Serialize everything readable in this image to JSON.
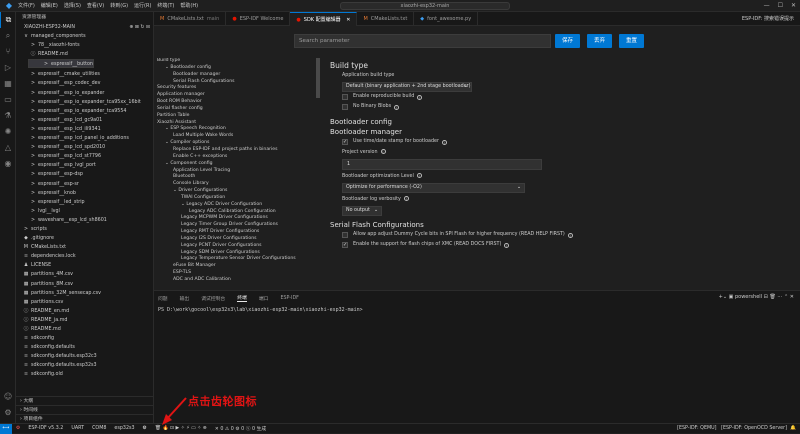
{
  "titlebar": {
    "menus": [
      "文件(F)",
      "编辑(E)",
      "选择(S)",
      "查看(V)",
      "转到(G)",
      "运行(R)",
      "终端(T)",
      "帮助(H)"
    ],
    "search": "xiaozhi-esp32-main"
  },
  "sidebar": {
    "header": "资源管理器",
    "project": "XIAOZHI-ESP32-MAIN",
    "tree": [
      {
        "label": "managed_components",
        "indent": 1,
        "icon": "v"
      },
      {
        "label": "78__xiaozhi-fonts",
        "indent": 2,
        "icon": ">"
      },
      {
        "label": "README.md",
        "indent": 2,
        "icon": "ⓘ"
      },
      {
        "label": "espressif__button",
        "indent": 2,
        "icon": ">",
        "selected": true
      },
      {
        "label": "espressif__cmake_utilities",
        "indent": 2,
        "icon": ">"
      },
      {
        "label": "espressif__esp_codec_dev",
        "indent": 2,
        "icon": ">"
      },
      {
        "label": "espressif__esp_io_expander",
        "indent": 2,
        "icon": ">"
      },
      {
        "label": "espressif__esp_io_expander_tca95xx_16bit",
        "indent": 2,
        "icon": ">"
      },
      {
        "label": "espressif__esp_io_expander_tca9554",
        "indent": 2,
        "icon": ">"
      },
      {
        "label": "espressif__esp_lcd_gc9a01",
        "indent": 2,
        "icon": ">"
      },
      {
        "label": "espressif__esp_lcd_ili9341",
        "indent": 2,
        "icon": ">"
      },
      {
        "label": "espressif__esp_lcd_panel_io_additions",
        "indent": 2,
        "icon": ">"
      },
      {
        "label": "espressif__esp_lcd_spd2010",
        "indent": 2,
        "icon": ">"
      },
      {
        "label": "espressif__esp_lcd_st7796",
        "indent": 2,
        "icon": ">"
      },
      {
        "label": "espressif__esp_lvgl_port",
        "indent": 2,
        "icon": ">"
      },
      {
        "label": "espressif__esp-dsp",
        "indent": 2,
        "icon": ">"
      },
      {
        "label": "espressif__esp-sr",
        "indent": 2,
        "icon": ">"
      },
      {
        "label": "espressif__knob",
        "indent": 2,
        "icon": ">"
      },
      {
        "label": "espressif__led_strip",
        "indent": 2,
        "icon": ">"
      },
      {
        "label": "lvgl__lvgl",
        "indent": 2,
        "icon": ">"
      },
      {
        "label": "waveshare__esp_lcd_sh8601",
        "indent": 2,
        "icon": ">"
      },
      {
        "label": "scripts",
        "indent": 1,
        "icon": ">"
      },
      {
        "label": ".gitignore",
        "indent": 1,
        "icon": "◆"
      },
      {
        "label": "CMakeLists.txt",
        "indent": 1,
        "icon": "M"
      },
      {
        "label": "dependencies.lock",
        "indent": 1,
        "icon": "≡"
      },
      {
        "label": "LICENSE",
        "indent": 1,
        "icon": "♟"
      },
      {
        "label": "partitions_4M.csv",
        "indent": 1,
        "icon": "▦"
      },
      {
        "label": "partitions_8M.csv",
        "indent": 1,
        "icon": "▦"
      },
      {
        "label": "partitions_32M_sensecap.csv",
        "indent": 1,
        "icon": "▦"
      },
      {
        "label": "partitions.csv",
        "indent": 1,
        "icon": "▦"
      },
      {
        "label": "README_en.md",
        "indent": 1,
        "icon": "ⓘ"
      },
      {
        "label": "README_ja.md",
        "indent": 1,
        "icon": "ⓘ"
      },
      {
        "label": "README.md",
        "indent": 1,
        "icon": "ⓘ"
      },
      {
        "label": "sdkconfig",
        "indent": 1,
        "icon": "≡"
      },
      {
        "label": "sdkconfig.defaults",
        "indent": 1,
        "icon": "≡"
      },
      {
        "label": "sdkconfig.defaults.esp32c3",
        "indent": 1,
        "icon": "≡"
      },
      {
        "label": "sdkconfig.defaults.esp32s3",
        "indent": 1,
        "icon": "≡"
      },
      {
        "label": "sdkconfig.old",
        "indent": 1,
        "icon": "≡"
      }
    ],
    "bottom": [
      "大纲",
      "时间线",
      "项目组件"
    ]
  },
  "tabs": [
    {
      "label": "CMakeLists.txt",
      "suffix": "main",
      "icon": "M",
      "color": "#e37933",
      "active": false
    },
    {
      "label": "ESP-IDF Welcome",
      "suffix": "",
      "icon": "●",
      "color": "#e51400",
      "active": false
    },
    {
      "label": "SDK 配置编辑器",
      "suffix": "",
      "icon": "●",
      "color": "#e51400",
      "active": true
    },
    {
      "label": "CMakeLists.txt",
      "suffix": "",
      "icon": "M",
      "color": "#e37933",
      "active": false
    },
    {
      "label": "font_awesome.py",
      "suffix": "",
      "icon": "◆",
      "color": "#3c9df0",
      "active": false
    }
  ],
  "tabs_right": "ESP-IDF: 搜索错误提示",
  "editor": {
    "search_placeholder": "Search parameter",
    "buttons": {
      "save": "保存",
      "discard": "丢弃",
      "reset": "重置"
    },
    "menu": [
      {
        "label": "Build type",
        "indent": 0
      },
      {
        "label": "Bootloader config",
        "indent": 1,
        "chev": "v"
      },
      {
        "label": "Bootloader manager",
        "indent": 2
      },
      {
        "label": "Serial Flash Configurations",
        "indent": 2
      },
      {
        "label": "Security features",
        "indent": 0
      },
      {
        "label": "Application manager",
        "indent": 0
      },
      {
        "label": "Boot ROM Behavior",
        "indent": 0
      },
      {
        "label": "Serial flasher config",
        "indent": 0
      },
      {
        "label": "Partition Table",
        "indent": 0
      },
      {
        "label": "Xiaozhi Assistant",
        "indent": 0
      },
      {
        "label": "ESP Speech Recognition",
        "indent": 1,
        "chev": "v"
      },
      {
        "label": "Load Multiple Wake Words",
        "indent": 2
      },
      {
        "label": "Compiler options",
        "indent": 1,
        "chev": "v"
      },
      {
        "label": "Replace ESP-IDF and project paths in binaries",
        "indent": 2
      },
      {
        "label": "Enable C++ exceptions",
        "indent": 2
      },
      {
        "label": "Component config",
        "indent": 1,
        "chev": "v"
      },
      {
        "label": "Application Level Tracing",
        "indent": 2
      },
      {
        "label": "Bluetooth",
        "indent": 2
      },
      {
        "label": "Console Library",
        "indent": 2
      },
      {
        "label": "Driver Configurations",
        "indent": 2,
        "chev": "v"
      },
      {
        "label": "TWAI Configuration",
        "indent": 3
      },
      {
        "label": "Legacy ADC Driver Configuration",
        "indent": 3,
        "chev": "v"
      },
      {
        "label": "Legacy ADC Calibration Configuration",
        "indent": 4
      },
      {
        "label": "Legacy MCPWM Driver Configurations",
        "indent": 3
      },
      {
        "label": "Legacy Timer Group Driver Configurations",
        "indent": 3
      },
      {
        "label": "Legacy RMT Driver Configurations",
        "indent": 3
      },
      {
        "label": "Legacy I2S Driver Configurations",
        "indent": 3
      },
      {
        "label": "Legacy PCNT Driver Configurations",
        "indent": 3
      },
      {
        "label": "Legacy SDM Driver Configurations",
        "indent": 3
      },
      {
        "label": "Legacy Temperature Sensor Driver Configurations",
        "indent": 3
      },
      {
        "label": "eFuse Bit Manager",
        "indent": 2
      },
      {
        "label": "ESP-TLS",
        "indent": 2
      },
      {
        "label": "ADC and ADC Calibration",
        "indent": 2
      }
    ],
    "content": {
      "build_type_title": "Build type",
      "app_build_type_label": "Application build type",
      "app_build_type_value": "Default (binary application + 2nd stage bootloader)",
      "reproducible_label": "Enable reproducible build",
      "no_blobs_label": "No Binary Blobs",
      "bootloader_config_title": "Bootloader config",
      "bootloader_manager_title": "Bootloader manager",
      "use_time_label": "Use time/date stamp for bootloader",
      "project_version_label": "Project version",
      "project_version_value": "1",
      "opt_level_label": "Bootloader optimization Level",
      "opt_level_value": "Optimize for performance (-O2)",
      "log_verbosity_label": "Bootloader log verbosity",
      "log_verbosity_value": "No output",
      "serial_flash_title": "Serial Flash Configurations",
      "dummy_cycle_label": "Allow app adjust Dummy Cycle bits in SPI Flash for higher frequency (READ HELP FIRST)",
      "xmc_label": "Enable the support for flash chips of XMC (READ DOCS FIRST)"
    }
  },
  "panel": {
    "tabs": [
      "问题",
      "输出",
      "调试控制台",
      "终端",
      "端口",
      "ESP-IDF"
    ],
    "active_tab": "终端",
    "shell": "powershell",
    "prompt": "PS D:\\work\\gocool\\esp32s3\\lab\\xiaozhi-esp32-main\\xiaozhi-esp32-main>"
  },
  "statusbar": {
    "items": [
      "ESP-IDF v5.3.2",
      "UART",
      "COM8",
      "esp32s3"
    ],
    "right": [
      "[ESP-IDF: QEMU]",
      "[ESP-IDF: OpenOCD Server]"
    ],
    "extra": "✕ 0  ⚠ 0   ⚙ 0   ⓢ 0   生成"
  },
  "annotation": {
    "text": "点击齿轮图标",
    "color": "#e01414"
  }
}
